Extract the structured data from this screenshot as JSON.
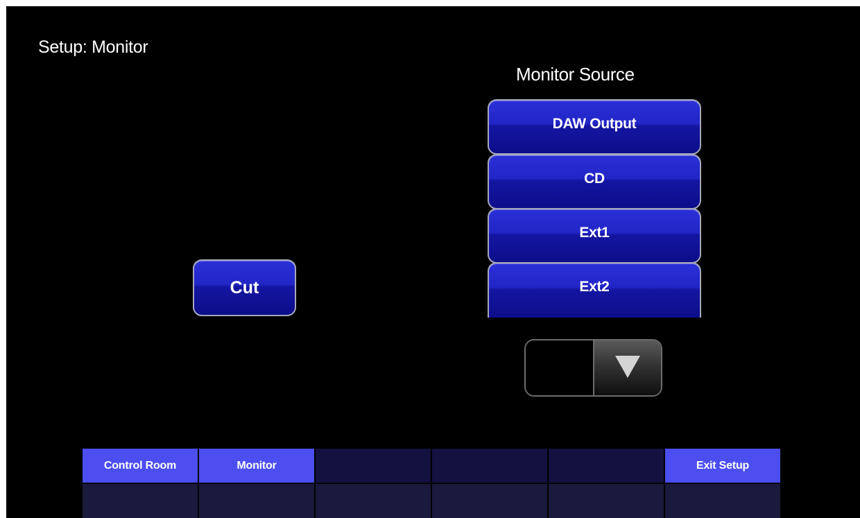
{
  "page": {
    "title": "Setup:  Monitor"
  },
  "monitor_source": {
    "title": "Monitor Source",
    "buttons": [
      {
        "label": "DAW Output"
      },
      {
        "label": "CD"
      },
      {
        "label": "Ext1"
      },
      {
        "label": "Ext2"
      }
    ]
  },
  "cut_button": {
    "label": "Cut"
  },
  "scroll": {
    "up_icon": "blank-scroll-up",
    "down_icon": "triangle-down-icon"
  },
  "tabs": [
    {
      "label": "Control Room",
      "active": true
    },
    {
      "label": "Monitor",
      "active": true
    },
    {
      "label": "",
      "active": false
    },
    {
      "label": "",
      "active": false
    },
    {
      "label": "",
      "active": false
    },
    {
      "label": "Exit Setup",
      "active": true
    }
  ],
  "colors": {
    "background": "#000000",
    "button_blue": "#1a1cb4",
    "tab_active": "#4c4ef0",
    "tab_inactive": "#13113f"
  }
}
